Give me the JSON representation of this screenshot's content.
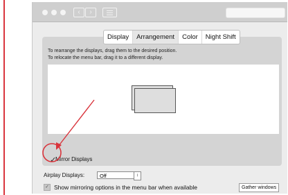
{
  "tabs": [
    {
      "label": "Display",
      "active": false
    },
    {
      "label": "Arrangement",
      "active": true
    },
    {
      "label": "Color",
      "active": false
    },
    {
      "label": "Night Shift",
      "active": false
    }
  ],
  "arrangement": {
    "instruction_line1": "To rearrange the displays, drag them to the desired position.",
    "instruction_line2": "To relocate the menu bar, drag it to a different display."
  },
  "mirror": {
    "label": "Mirror Displays",
    "checked": true
  },
  "airplay": {
    "label": "Airplay Displays:",
    "value": "Off"
  },
  "mirroring_options": {
    "label": "Show mirroring options in the menu bar when available",
    "checked": true
  },
  "gather_button": {
    "label": "Gather windows"
  },
  "colors": {
    "annotation_red": "#d9343c",
    "panel_gray": "#d4d4d4"
  }
}
